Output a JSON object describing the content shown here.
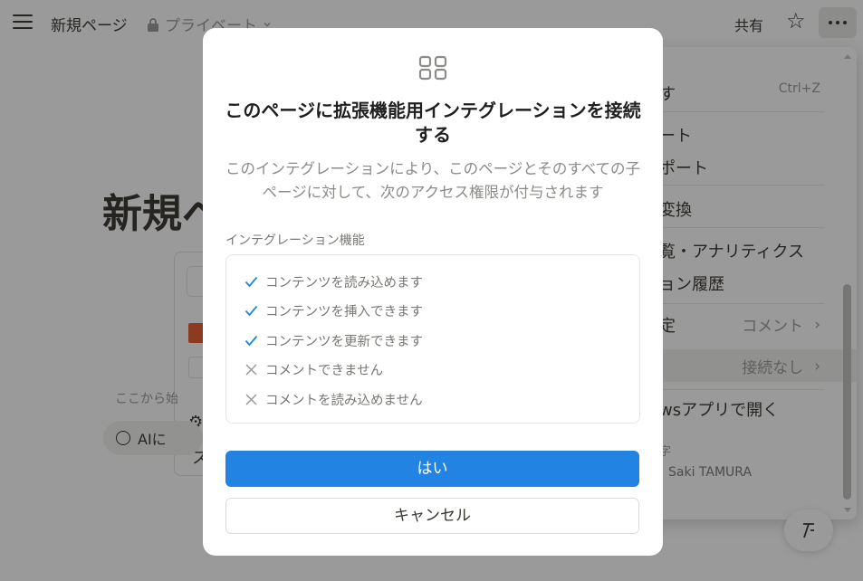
{
  "topbar": {
    "page_title": "新規ページ",
    "privacy_label": "プライベート",
    "share_label": "共有"
  },
  "page": {
    "title": "新規ペ",
    "hint": "ここから始",
    "ai_button": "AIに"
  },
  "menu": {
    "items": [
      {
        "label": "す",
        "shortcut": "Ctrl+Z"
      },
      {
        "label": "ート"
      },
      {
        "label": "ポート"
      },
      {
        "label": "変換"
      },
      {
        "label": "覧・アナリティクス"
      },
      {
        "label": "ョン履歴"
      },
      {
        "label": "定",
        "value": "コメント"
      },
      {
        "label": "",
        "value": "接続なし"
      },
      {
        "label": "wsアプリで開く"
      }
    ],
    "footer_label": "字",
    "footer_user": "Saki TAMURA"
  },
  "modal": {
    "icon": "grid-icon",
    "title": "このページに拡張機能用インテグレーションを接続する",
    "description": "このインテグレーションにより、このページとそのすべての子ページに対して、次のアクセス権限が付与されます",
    "section_label": "インテグレーション機能",
    "capabilities": [
      {
        "label": "コンテンツを読み込めます",
        "allowed": true
      },
      {
        "label": "コンテンツを挿入できます",
        "allowed": true
      },
      {
        "label": "コンテンツを更新できます",
        "allowed": true
      },
      {
        "label": "コメントできません",
        "allowed": false
      },
      {
        "label": "コメントを読み込めません",
        "allowed": false
      }
    ],
    "confirm_label": "はい",
    "cancel_label": "キャンセル"
  },
  "colors": {
    "accent": "#2383e2",
    "check": "#2383e2",
    "cross": "#9b9a97"
  }
}
